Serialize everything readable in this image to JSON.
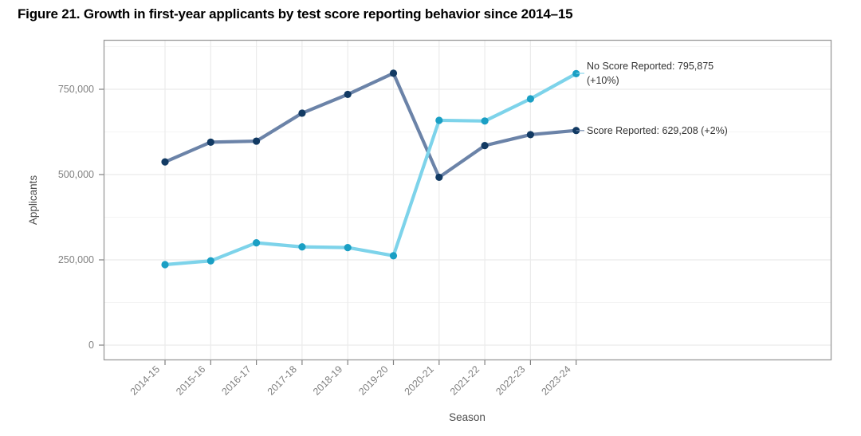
{
  "figure": {
    "title": "Figure 21. Growth in first-year applicants by test score reporting behavior since 2014–15"
  },
  "axes": {
    "x_title": "Season",
    "y_title": "Applicants",
    "y_ticks": [
      "0",
      "250,000",
      "500,000",
      "750,000"
    ],
    "x_ticks": [
      "2014-15",
      "2015-16",
      "2016-17",
      "2017-18",
      "2018-19",
      "2019-20",
      "2020-21",
      "2021-22",
      "2022-23",
      "2023-24"
    ]
  },
  "annotations": {
    "no_score_line1": "No Score Reported: 795,875",
    "no_score_line2": "(+10%)",
    "score_reported": "Score Reported: 629,208 (+2%)"
  },
  "colors": {
    "score_reported_line": "#6b83a8",
    "score_reported_marker": "#123a63",
    "no_score_line": "#7dd3ea",
    "no_score_marker": "#1a9fc4",
    "grid_major": "#ebebeb",
    "grid_minor": "#f4f4f4",
    "panel_border": "#9a9a9a",
    "text": "#333333"
  },
  "chart_data": {
    "type": "line",
    "title": "Figure 21. Growth in first-year applicants by test score reporting behavior since 2014–15",
    "xlabel": "Season",
    "ylabel": "Applicants",
    "categories": [
      "2014-15",
      "2015-16",
      "2016-17",
      "2017-18",
      "2018-19",
      "2019-20",
      "2020-21",
      "2021-22",
      "2022-23",
      "2023-24"
    ],
    "ylim": [
      0,
      875000
    ],
    "yticks": [
      0,
      250000,
      500000,
      750000
    ],
    "grid": true,
    "legend": "annotated at line ends",
    "series": [
      {
        "name": "Score Reported",
        "color": "#6b83a8",
        "marker_color": "#123a63",
        "values": [
          537000,
          595000,
          598000,
          680000,
          735000,
          797000,
          492000,
          585000,
          617000,
          629208
        ],
        "end_label": "Score Reported: 629,208 (+2%)"
      },
      {
        "name": "No Score Reported",
        "color": "#7dd3ea",
        "marker_color": "#1a9fc4",
        "values": [
          236000,
          247000,
          300000,
          288000,
          286000,
          262000,
          659000,
          657000,
          722000,
          795875
        ],
        "end_label": "No Score Reported: 795,875 (+10%)"
      }
    ],
    "annotations": [
      {
        "text": "No Score Reported: 795,875 (+10%)",
        "at_category": "2023-24",
        "series": "No Score Reported"
      },
      {
        "text": "Score Reported: 629,208 (+2%)",
        "at_category": "2023-24",
        "series": "Score Reported"
      }
    ]
  }
}
